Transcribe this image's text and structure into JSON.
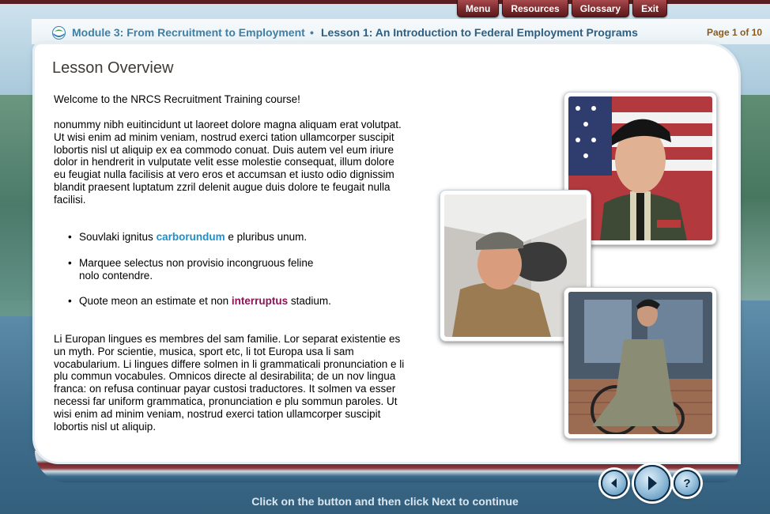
{
  "menu": {
    "items": [
      "Menu",
      "Resources",
      "Glossary",
      "Exit"
    ]
  },
  "breadcrumb": {
    "module": "Module 3: From Recruitment to Employment",
    "separator": "•",
    "lesson": "Lesson 1: An Introduction to Federal Employment Programs"
  },
  "page_indicator": "Page 1 of 10",
  "content": {
    "title": "Lesson Overview",
    "welcome": "Welcome to the NRCS Recruitment Training course!",
    "para1": "nonummy nibh euitincidunt ut laoreet dolore magna aliquam erat volutpat. Ut wisi enim ad minim veniam, nostrud exerci tation ullamcorper suscipit lobortis nisl ut aliquip ex ea commodo conuat. Duis autem vel eum iriure dolor in hendrerit in vulputate velit esse molestie consequat, illum dolore eu feugiat nulla facilisis at vero eros et accumsan et iusto odio dignissim blandit praesent luptatum zzril delenit augue duis dolore te feugait nulla facilisi.",
    "bullets": [
      {
        "before": "Souvlaki ignitus ",
        "highlight": "carborundum",
        "after": " e pluribus unum."
      },
      {
        "line1": "Marquee selectus non provisio incongruous feline",
        "line2": "nolo contendre."
      },
      {
        "before": "Quote meon an estimate et non ",
        "highlight": "interruptus",
        "after": " stadium."
      }
    ],
    "para2": "Li Europan lingues es membres del sam familie. Lor separat existentie es un myth. Por scientie, musica, sport etc, li tot Europa usa li sam vocabularium. Li lingues differe solmen in li grammaticali pronunciation e li plu commun vocabules. Omnicos directe al desirabilita; de un nov lingua franca: on refusa continuar payar custosi traductores. It solmen va esser necessi far uniform grammatica, pronunciation e plu sommun paroles. Ut wisi enim ad minim veniam, nostrud exerci tation ullamcorper suscipit lobortis nisl ut aliquip."
  },
  "footer": {
    "instruction": "Click on the button and then click Next to continue"
  },
  "icons": {
    "back": "back-arrow-icon",
    "next": "next-arrow-icon",
    "help": "help-question-icon",
    "logo": "nrcs-logo-icon"
  },
  "colors": {
    "menu_button": "#7b2a2d",
    "breadcrumb_module": "#3f7fa6",
    "breadcrumb_lesson": "#2d5f82",
    "page_indicator": "#8a5a1a",
    "highlight_blue": "#1e8fc9",
    "highlight_maroon": "#8b1457"
  }
}
